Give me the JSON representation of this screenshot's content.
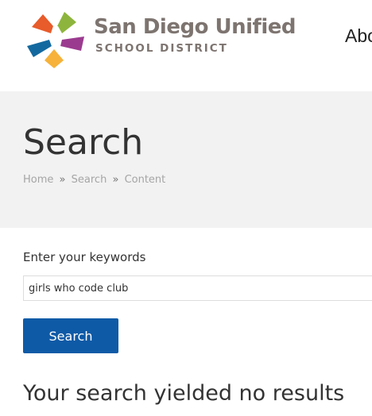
{
  "header": {
    "logo": {
      "name": "San Diego Unified",
      "subtitle": "SCHOOL DISTRICT",
      "colors": [
        "#e85b2a",
        "#8db53d",
        "#13699f",
        "#9b3b8f",
        "#f6b23a"
      ]
    },
    "nav_partial": "Abo"
  },
  "banner": {
    "title": "Search",
    "breadcrumb": [
      "Home",
      "Search",
      "Content"
    ],
    "separator": "»"
  },
  "search_form": {
    "label": "Enter your keywords",
    "value": "girls who code club",
    "button_label": "Search",
    "button_color": "#0e5aa7"
  },
  "results": {
    "heading": "Your search yielded no results"
  }
}
